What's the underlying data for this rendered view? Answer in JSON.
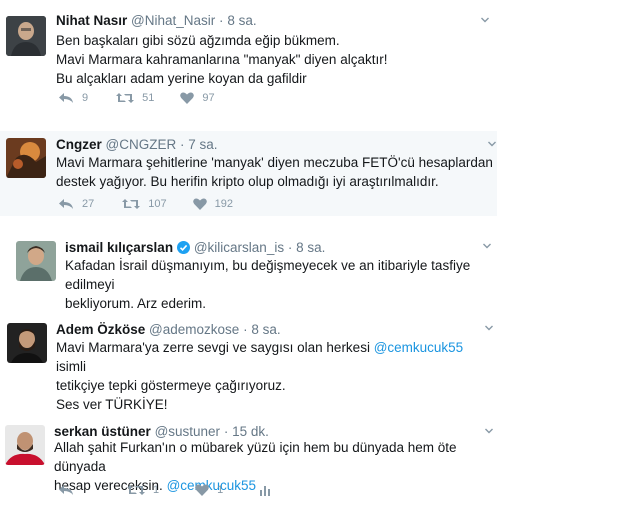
{
  "colors": {
    "name": "#14171a",
    "muted": "#657786",
    "link": "#1b95e0",
    "action": "#8899a6",
    "verified": "#1da1f2"
  },
  "tweets": [
    {
      "name": "Nihat Nasır",
      "handle": "@Nihat_Nasir",
      "dot": "·",
      "time": "8 sa.",
      "lines": [
        "Ben başkaları gibi sözü ağzımda eğip bükmem.",
        "Mavi Marmara kahramanlarına \"manyak\" diyen alçaktır!",
        "Bu alçakları adam yerine koyan da gafildir"
      ],
      "replies": "9",
      "retweets": "51",
      "likes": "97"
    },
    {
      "name": "Cngzer",
      "handle": "@CNGZER",
      "dot": "·",
      "time": "7 sa.",
      "lines": [
        "Mavi Marmara şehitlerine 'manyak' diyen meczuba FETÖ'cü hesaplardan",
        "destek yağıyor. Bu herifin kripto olup olmadığı iyi araştırılmalıdır."
      ],
      "replies": "27",
      "retweets": "107",
      "likes": "192"
    },
    {
      "name": "ismail kılıçarslan",
      "handle": "@kilicarslan_is",
      "dot": "·",
      "time": "8 sa.",
      "lines": [
        "Kafadan İsrail düşmanıyım, bu değişmeyecek ve an itibariyle tasfiye edilmeyi",
        "bekliyorum. Arz ederim."
      ]
    },
    {
      "name": "Adem Özköse",
      "handle": "@ademozkose",
      "dot": "·",
      "time": "8 sa.",
      "line1_pre": "Mavi Marmara'ya zerre sevgi ve saygısı olan herkesi ",
      "line1_mention": "@cemkucuk55",
      "line1_post": " isimli",
      "line2": "tetikçiye tepki göstermeye çağırıyoruz.",
      "line3": "Ses ver TÜRKİYE!"
    },
    {
      "name": "serkan üstüner",
      "handle": "@sustuner",
      "dot": "·",
      "time": "15 dk.",
      "line1": "Allah şahit Furkan'ın o mübarek yüzü için hem bu dünyada hem öte dünyada",
      "line2_pre": "hesap vereceksin. ",
      "line2_mention": "@cemkucuk55",
      "retweets": "1",
      "likes": "1"
    }
  ]
}
